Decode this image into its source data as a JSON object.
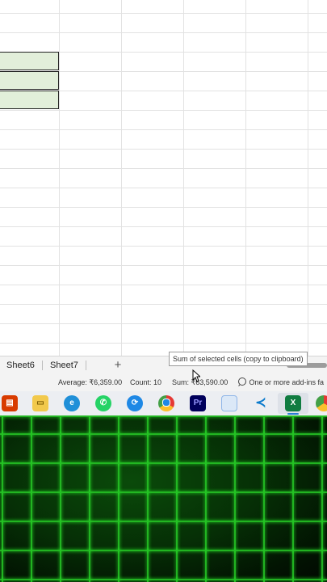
{
  "sheet_tabs": [
    {
      "label": "Sheet6"
    },
    {
      "label": "Sheet7"
    }
  ],
  "add_sheet_symbol": "+",
  "tooltip": {
    "text": "Sum of selected cells (copy to clipboard)"
  },
  "status_bar": {
    "average": "Average: ₹6,359.00",
    "count": "Count: 10",
    "sum": "Sum: ₹63,590.00",
    "addins": "One or more add-ins fa"
  },
  "taskbar": {
    "apps": [
      {
        "icon": "office-app-icon",
        "color": "#d83b01"
      },
      {
        "icon": "file-explorer-icon",
        "color": "#f2c94c"
      },
      {
        "icon": "edge-icon",
        "color": "#1f8fd8"
      },
      {
        "icon": "whatsapp-icon",
        "color": "#25d366"
      },
      {
        "icon": "sync-app-icon",
        "color": "#1e88e5"
      },
      {
        "icon": "chrome-icon",
        "color": "#e53935"
      },
      {
        "icon": "premiere-pro-icon",
        "color": "#00005b",
        "label": "Pr"
      },
      {
        "icon": "notepad-icon",
        "color": "#8fb6e8"
      },
      {
        "icon": "vscode-icon",
        "color": "#0a7acc"
      },
      {
        "icon": "excel-icon",
        "color": "#107c41",
        "label": "X"
      },
      {
        "icon": "chrome-profile-icon",
        "color": "#e53935"
      }
    ]
  },
  "colors": {
    "selected_cell_fill": "#e2efda",
    "video_grid_line": "#25c425",
    "video_background": "#021402"
  }
}
